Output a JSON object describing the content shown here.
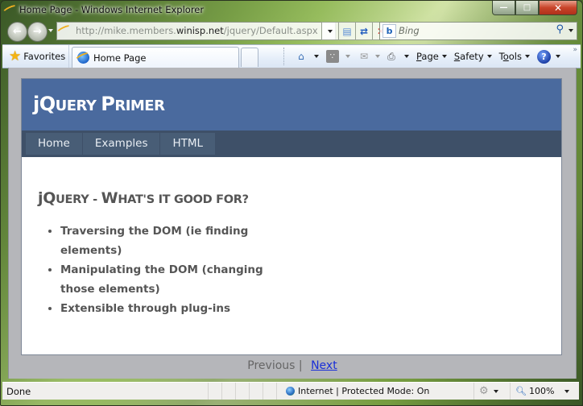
{
  "window": {
    "title": "Home Page - Windows Internet Explorer",
    "controls": {
      "minimize_icon": "minimize-icon",
      "maximize_icon": "maximize-icon",
      "close_icon": "close-icon"
    }
  },
  "nav": {
    "back_icon": "back-arrow-icon",
    "forward_icon": "forward-arrow-icon",
    "address": {
      "prefix": "http://mike.members.",
      "domain": "winisp.net",
      "path": "/jquery/Default.aspx"
    },
    "buttons": [
      "compatibility-view-icon",
      "refresh-icon",
      "stop-icon"
    ],
    "search": {
      "provider": "Bing",
      "placeholder": "Bing"
    }
  },
  "command_bar": {
    "favorites_label": "Favorites",
    "tab_title": "Home Page",
    "menus": [
      {
        "label": "Page",
        "accesskey": "P"
      },
      {
        "label": "Safety",
        "accesskey": "S"
      },
      {
        "label": "Tools",
        "accesskey": "o"
      }
    ]
  },
  "page": {
    "site_title_first": "jQ",
    "site_title_rest": "UERY ",
    "site_title_p": "P",
    "site_title_rest2": "RIMER",
    "menu": [
      "Home",
      "Examples",
      "HTML"
    ],
    "heading_a": "jQ",
    "heading_b": "UERY - ",
    "heading_c": "W",
    "heading_d": "HAT'S IT GOOD FOR?",
    "bullets": [
      "Traversing the DOM (ie finding elements)",
      "Manipulating the DOM (changing those elements)",
      "Extensible through plug-ins"
    ],
    "pager": {
      "previous": "Previous",
      "separator": "|",
      "next": "Next"
    },
    "colors": {
      "header": "#4a6a9e",
      "menubar": "#3e5068",
      "link": "#1a2fd8"
    }
  },
  "status": {
    "text": "Done",
    "zone": "Internet | Protected Mode: On",
    "zoom": "100%"
  }
}
